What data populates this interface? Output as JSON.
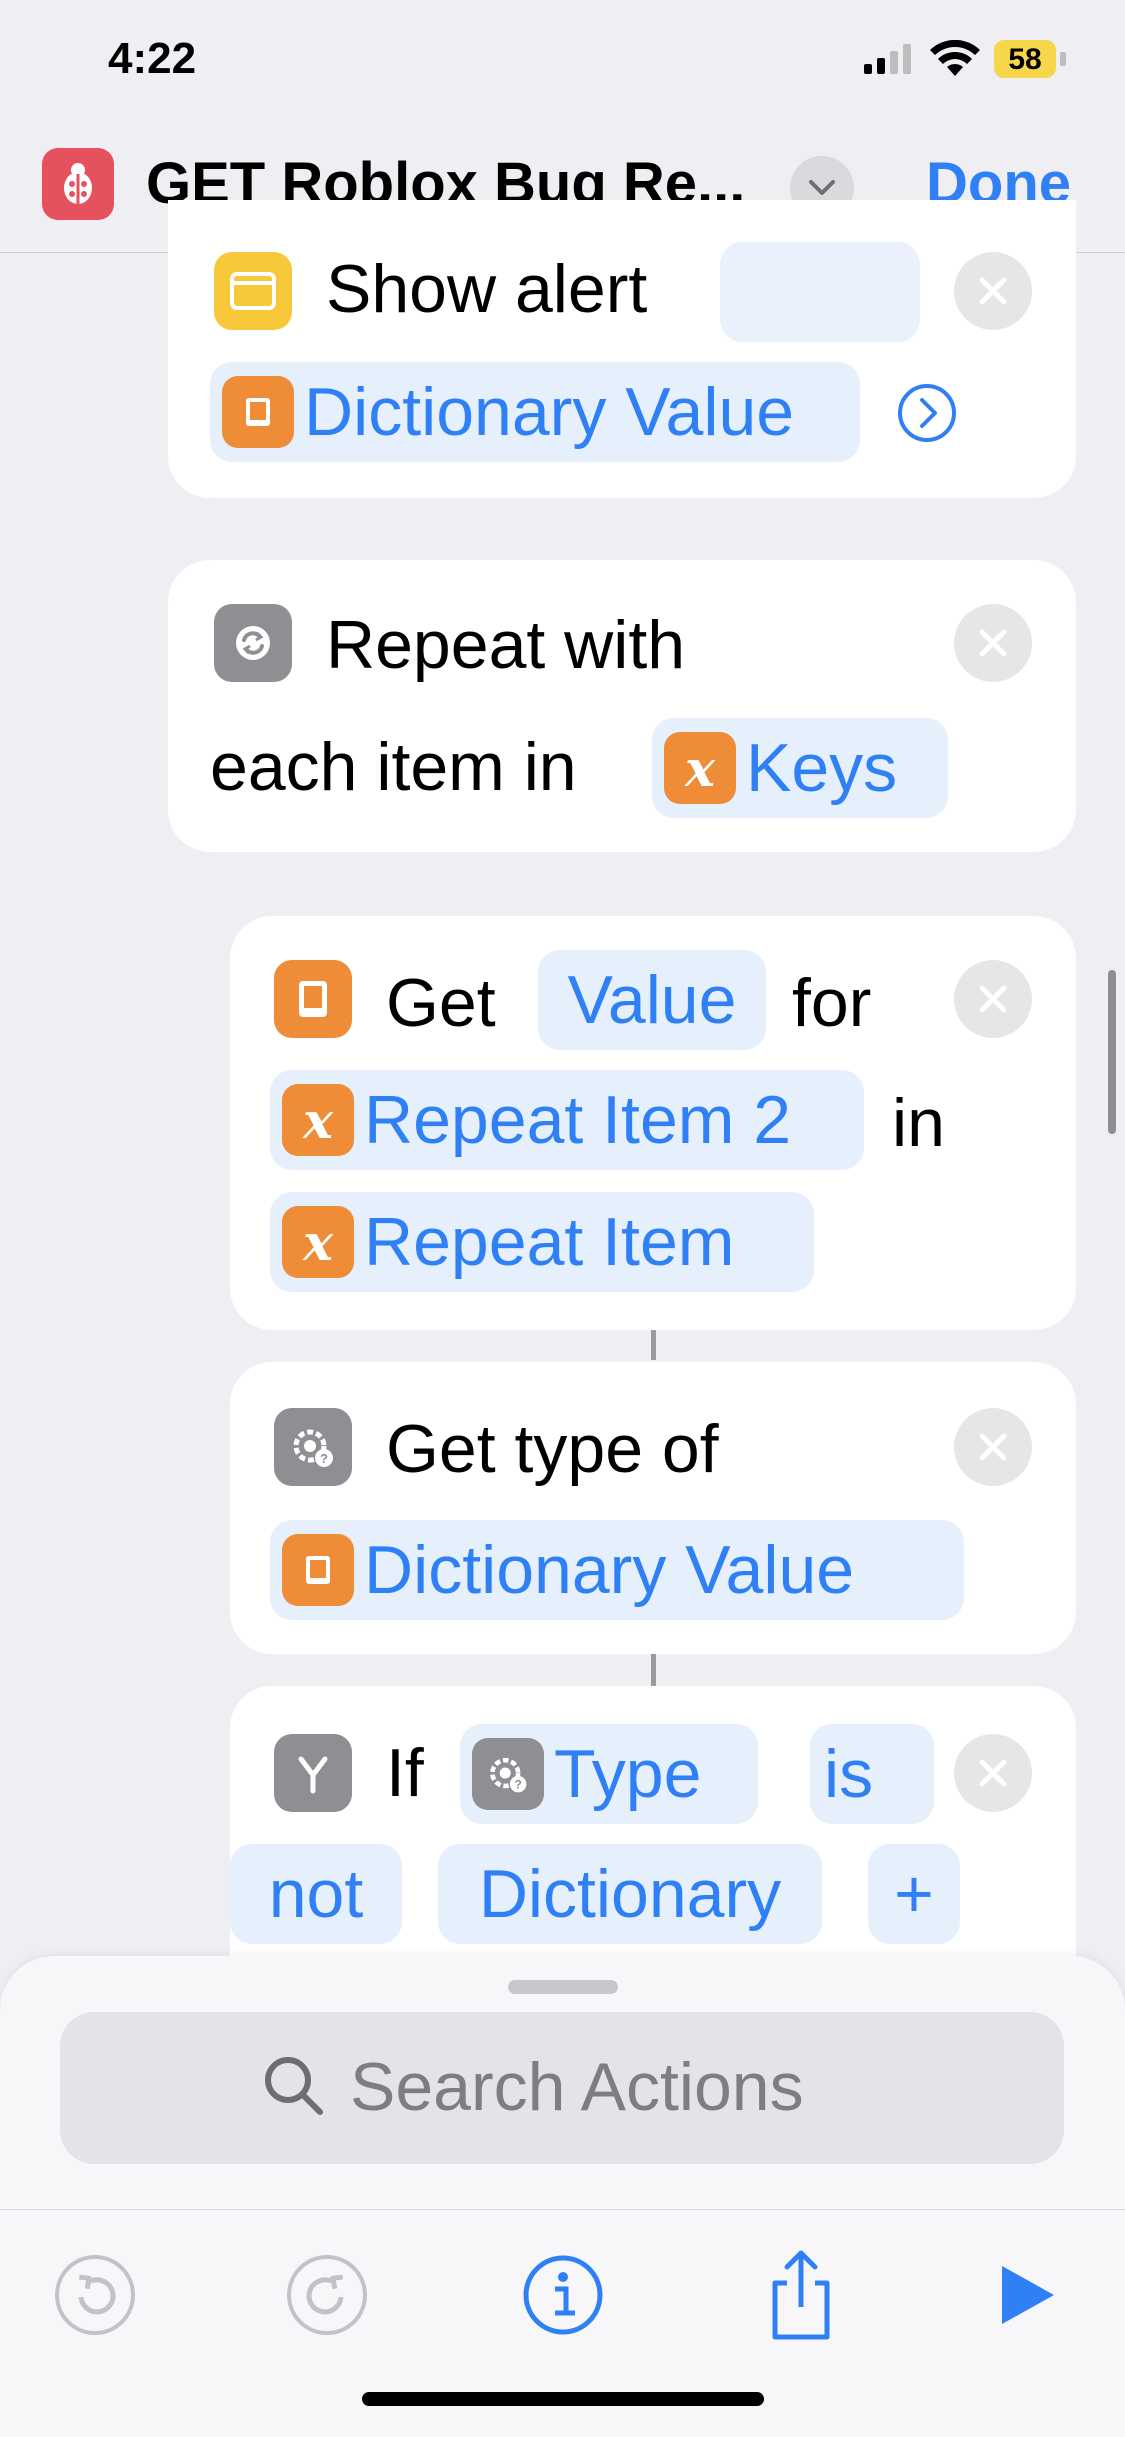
{
  "status_bar": {
    "time": "4:22",
    "battery": "58"
  },
  "nav": {
    "title": "GET Roblox Bug Re...",
    "done_label": "Done"
  },
  "actions": {
    "show_alert": {
      "title": "Show alert",
      "param": "Dictionary Value"
    },
    "repeat": {
      "title": "Repeat with",
      "line2": "each item in",
      "param": "Keys"
    },
    "get_value": {
      "word_get": "Get",
      "param_value": "Value",
      "word_for": "for",
      "param_key": "Repeat Item 2",
      "word_in": "in",
      "param_dict": "Repeat Item"
    },
    "get_type": {
      "title": "Get type of",
      "param": "Dictionary Value"
    },
    "if": {
      "word_if": "If",
      "param_input": "Type",
      "cond_is": "is",
      "cond_not": "not",
      "param_value": "Dictionary",
      "add": "+"
    }
  },
  "search": {
    "placeholder": "Search Actions"
  },
  "icons": {
    "app": "ladybug-icon",
    "show_alert": "alert-window-icon",
    "repeat": "repeat-icon",
    "dictionary": "book-icon",
    "variable": "x-variable-icon",
    "get_type": "gear-question-icon",
    "if": "branch-icon",
    "toolbar": [
      "undo-icon",
      "redo-icon",
      "info-icon",
      "share-icon",
      "play-icon"
    ]
  },
  "colors": {
    "accent": "#2f7ff5",
    "variable_orange": "#ef8c37",
    "app_icon": "#e5525e"
  }
}
